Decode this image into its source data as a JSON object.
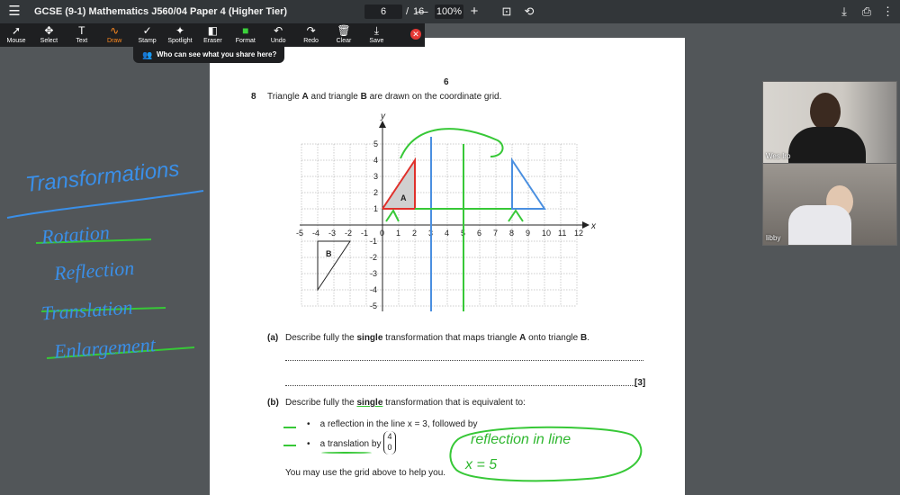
{
  "topbar": {
    "title": "GCSE (9-1) Mathematics J560/04 Paper 4 (Higher Tier)",
    "page_current": "6",
    "page_sep": "/",
    "page_total": "16",
    "zoom": "100%"
  },
  "drawbar": {
    "tools": [
      {
        "label": "Mouse",
        "icon": "mouse-pointer-icon"
      },
      {
        "label": "Select",
        "icon": "move-icon"
      },
      {
        "label": "Text",
        "icon": "text-icon"
      },
      {
        "label": "Draw",
        "icon": "pen-squiggle-icon",
        "active": true
      },
      {
        "label": "Stamp",
        "icon": "check-icon"
      },
      {
        "label": "Spotlight",
        "icon": "wand-icon"
      },
      {
        "label": "Eraser",
        "icon": "eraser-icon"
      },
      {
        "label": "Format",
        "icon": "color-swatch-icon"
      },
      {
        "label": "Undo",
        "icon": "undo-icon"
      },
      {
        "label": "Redo",
        "icon": "redo-icon"
      },
      {
        "label": "Clear",
        "icon": "trash-icon"
      },
      {
        "label": "Save",
        "icon": "save-icon"
      }
    ],
    "share_notice": "Who can see what you share here?",
    "format_color": "#3bd13b",
    "close_color": "#e53935"
  },
  "page": {
    "page_number": "6",
    "question_number": "8",
    "intro_pre": "Triangle ",
    "intro_a": "A",
    "intro_mid": " and triangle ",
    "intro_b": "B",
    "intro_post": " are drawn on the coordinate grid.",
    "grid": {
      "x_axis_label": "x",
      "y_axis_label": "y",
      "x_ticks": [
        "-5",
        "-4",
        "-3",
        "-2",
        "-1",
        "0",
        "1",
        "2",
        "3",
        "4",
        "5",
        "6",
        "7",
        "8",
        "9",
        "10",
        "11",
        "12"
      ],
      "y_ticks_pos": [
        "5",
        "4",
        "3",
        "2",
        "1"
      ],
      "y_ticks_neg": [
        "-1",
        "-2",
        "-3",
        "-4",
        "-5"
      ],
      "label_a": "A",
      "label_b": "B"
    },
    "part_a": {
      "label": "(a)",
      "pre": "Describe fully the ",
      "bold": "single",
      "mid": " transformation that maps triangle ",
      "a": "A",
      "mid2": " onto triangle ",
      "b": "B",
      "post": ".",
      "marks": "[3]"
    },
    "part_b": {
      "label": "(b)",
      "pre": "Describe fully the ",
      "bold": "single",
      "post": " transformation that is equivalent to:",
      "bullet1": "a reflection in the line x = 3, followed by",
      "bullet2_pre": "a translation by",
      "vector_top": "4",
      "vector_bottom": "0",
      "help": "You may use the grid above to help you."
    },
    "handwritten": {
      "answer_line1": "reflection in line",
      "answer_line2": "x = 5"
    }
  },
  "annotations": {
    "heading": "Transformations",
    "items": [
      "Rotation",
      "Reflection",
      "Translation",
      "Enlargement"
    ]
  },
  "participants": [
    {
      "name": "Wes Iro"
    },
    {
      "name": "libby"
    }
  ]
}
